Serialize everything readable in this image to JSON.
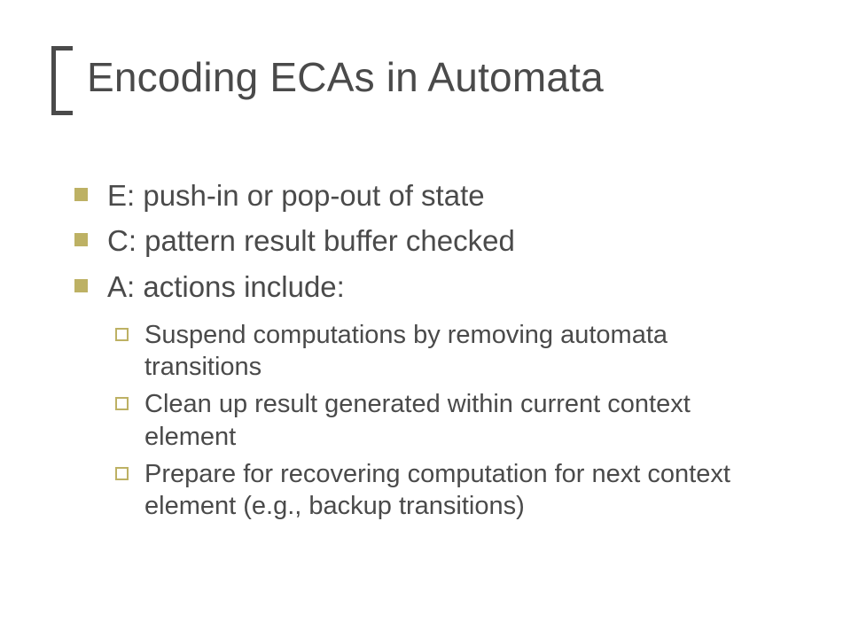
{
  "title": "Encoding ECAs in Automata",
  "bullets": {
    "e": "E:    push-in or pop-out of state",
    "c": "C:     pattern result buffer checked",
    "a": "A:    actions include:",
    "sub1": "Suspend computations by removing automata transitions",
    "sub2": "Clean up result generated within current context element",
    "sub3": "Prepare for recovering computation for next context element (e.g., backup transitions)"
  }
}
